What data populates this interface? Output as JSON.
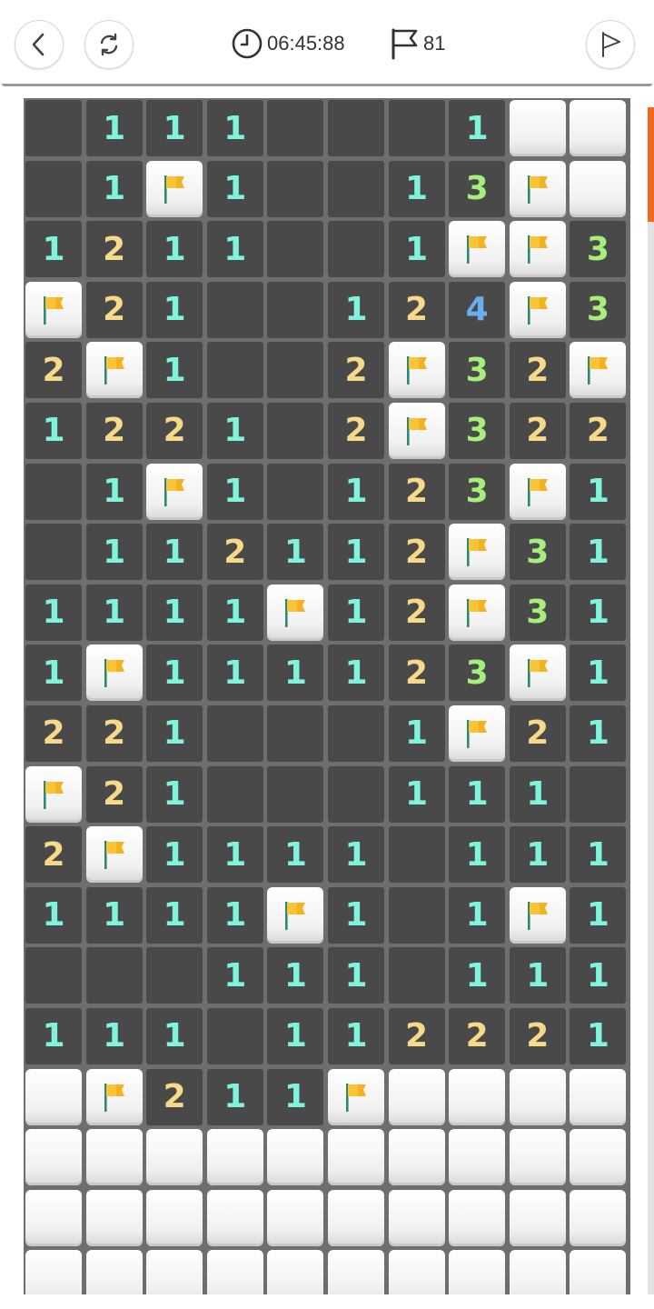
{
  "header": {
    "timer": "06:45:88",
    "flags_remaining": "81",
    "icons": {
      "back": "chevron-left-icon",
      "restart": "restart-icon",
      "clock": "clock-icon",
      "flag_counter": "flag-icon",
      "flag_mode": "flag-outline-icon"
    }
  },
  "colors": {
    "open_cell": "#494949",
    "grid": "#6e6e6e",
    "num_1": "#7ff3dc",
    "num_2": "#f7d98a",
    "num_3": "#a7ef7c",
    "num_4": "#6aaef0",
    "flag": "#f5b21f",
    "scroll_thumb": "#ef6a1e"
  },
  "board": {
    "columns": 10,
    "legend": "O = open empty, digit = revealed number, F = flag, C = covered",
    "rows": [
      [
        "O",
        "1",
        "1",
        "1",
        "O",
        "O",
        "O",
        "1",
        "C",
        "C"
      ],
      [
        "O",
        "1",
        "F",
        "1",
        "O",
        "O",
        "1",
        "3",
        "F",
        "C"
      ],
      [
        "1",
        "2",
        "1",
        "1",
        "O",
        "O",
        "1",
        "F",
        "F",
        "3"
      ],
      [
        "F",
        "2",
        "1",
        "O",
        "O",
        "1",
        "2",
        "4",
        "F",
        "3"
      ],
      [
        "2",
        "F",
        "1",
        "O",
        "O",
        "2",
        "F",
        "3",
        "2",
        "F"
      ],
      [
        "1",
        "2",
        "2",
        "1",
        "O",
        "2",
        "F",
        "3",
        "2",
        "2"
      ],
      [
        "O",
        "1",
        "F",
        "1",
        "O",
        "1",
        "2",
        "3",
        "F",
        "1"
      ],
      [
        "O",
        "1",
        "1",
        "2",
        "1",
        "1",
        "2",
        "F",
        "3",
        "1"
      ],
      [
        "1",
        "1",
        "1",
        "1",
        "F",
        "1",
        "2",
        "F",
        "3",
        "1"
      ],
      [
        "1",
        "F",
        "1",
        "1",
        "1",
        "1",
        "2",
        "3",
        "F",
        "1"
      ],
      [
        "2",
        "2",
        "1",
        "O",
        "O",
        "O",
        "1",
        "F",
        "2",
        "1"
      ],
      [
        "F",
        "2",
        "1",
        "O",
        "O",
        "O",
        "1",
        "1",
        "1",
        "O"
      ],
      [
        "2",
        "F",
        "1",
        "1",
        "1",
        "1",
        "O",
        "1",
        "1",
        "1"
      ],
      [
        "1",
        "1",
        "1",
        "1",
        "F",
        "1",
        "O",
        "1",
        "F",
        "1"
      ],
      [
        "O",
        "O",
        "O",
        "1",
        "1",
        "1",
        "O",
        "1",
        "1",
        "1"
      ],
      [
        "1",
        "1",
        "1",
        "O",
        "1",
        "1",
        "2",
        "2",
        "2",
        "1"
      ],
      [
        "C",
        "F",
        "2",
        "1",
        "1",
        "F",
        "C",
        "C",
        "C",
        "C"
      ],
      [
        "C",
        "C",
        "C",
        "C",
        "C",
        "C",
        "C",
        "C",
        "C",
        "C"
      ],
      [
        "C",
        "C",
        "C",
        "C",
        "C",
        "C",
        "C",
        "C",
        "C",
        "C"
      ],
      [
        "C",
        "C",
        "C",
        "C",
        "C",
        "C",
        "C",
        "C",
        "C",
        "C"
      ]
    ]
  }
}
